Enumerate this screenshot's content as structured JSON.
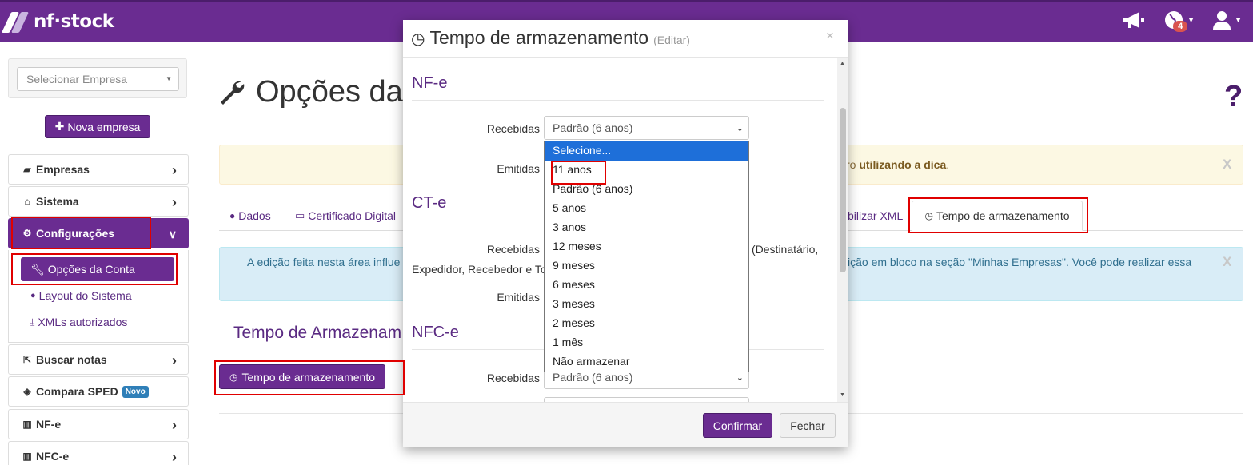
{
  "app": {
    "logo_text": "nf·stock",
    "notif_count": "4"
  },
  "sidebar": {
    "company_placeholder": "Selecionar Empresa",
    "new_company_label": "Nova empresa",
    "items": [
      {
        "label": "Empresas"
      },
      {
        "label": "Sistema"
      },
      {
        "label": "Configurações"
      },
      {
        "label": "Buscar notas"
      },
      {
        "label": "Compara SPED",
        "badge": "Novo"
      },
      {
        "label": "NF-e"
      },
      {
        "label": "NFC-e"
      }
    ],
    "submenu": [
      {
        "label": "Opções da Conta"
      },
      {
        "label": "Layout do Sistema"
      },
      {
        "label": "XMLs autorizados"
      }
    ]
  },
  "main": {
    "title": "Opções da",
    "alert_warning": {
      "text_prefix": "ro ",
      "text_bold": "utilizando a dica",
      "text_suffix": ".",
      "close": "X"
    },
    "tabs": [
      {
        "label": "Dados"
      },
      {
        "label": "Certificado Digital"
      },
      {
        "label": "bilizar XML"
      },
      {
        "label": "Tempo de armazenamento"
      }
    ],
    "info_alert": {
      "line1_left": "A edição feita nesta área influe",
      "line1_right": "ição em bloco na seção \"Minhas Empresas\". Você pode realizar essa",
      "close": "X"
    },
    "section_title": "Tempo de Armazenam",
    "button_label": "Tempo de armazenamento"
  },
  "modal": {
    "title": "Tempo de armazenamento",
    "subtitle": "(Editar)",
    "close": "×",
    "sections": [
      {
        "title": "NF-e"
      },
      {
        "title": "CT-e"
      },
      {
        "title": "NFC-e"
      }
    ],
    "labels": {
      "recebidas": "Recebidas",
      "emitidas": "Emitidas"
    },
    "nfe_recebidas_value": "Padrão (6 anos)",
    "cte_text_right": "(Destinatário,",
    "cte_text_line2": "Expedidor, Recebedor e To",
    "nfce_recebidas_value": "Padrão (6 anos)",
    "confirm_label": "Confirmar",
    "close_label": "Fechar"
  },
  "dropdown": {
    "options": [
      "Selecione...",
      "11 anos",
      "Padrão (6 anos)",
      "5 anos",
      "3 anos",
      "12 meses",
      "9 meses",
      "6 meses",
      "3 meses",
      "2 meses",
      "1 mês",
      "Não armazenar"
    ],
    "highlighted_index": 0
  },
  "colors": {
    "brand": "#6a2c91",
    "info_bg": "#d9edf7",
    "warning_bg": "#fcf8e3",
    "highlight": "#e00000"
  }
}
